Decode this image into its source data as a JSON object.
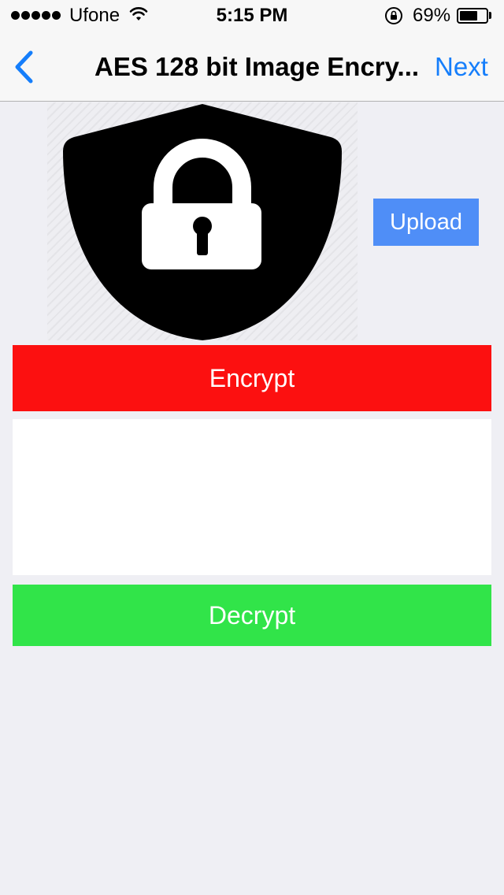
{
  "status_bar": {
    "carrier": "Ufone",
    "time": "5:15 PM",
    "battery_percent": "69%",
    "battery_level": 0.69,
    "icons": [
      "signal-dots-icon",
      "wifi-icon",
      "rotation-lock-icon",
      "battery-icon"
    ]
  },
  "nav": {
    "back_icon": "chevron-left-icon",
    "title": "AES 128 bit Image Encry...",
    "next_label": "Next",
    "accent_color": "#157efb"
  },
  "image_preview": {
    "icon": "shield-lock-icon"
  },
  "actions": {
    "upload_label": "Upload",
    "encrypt_label": "Encrypt",
    "decrypt_label": "Decrypt",
    "output_value": "",
    "colors": {
      "upload": "#4f8ef7",
      "encrypt": "#fc1010",
      "decrypt": "#31e449"
    }
  }
}
